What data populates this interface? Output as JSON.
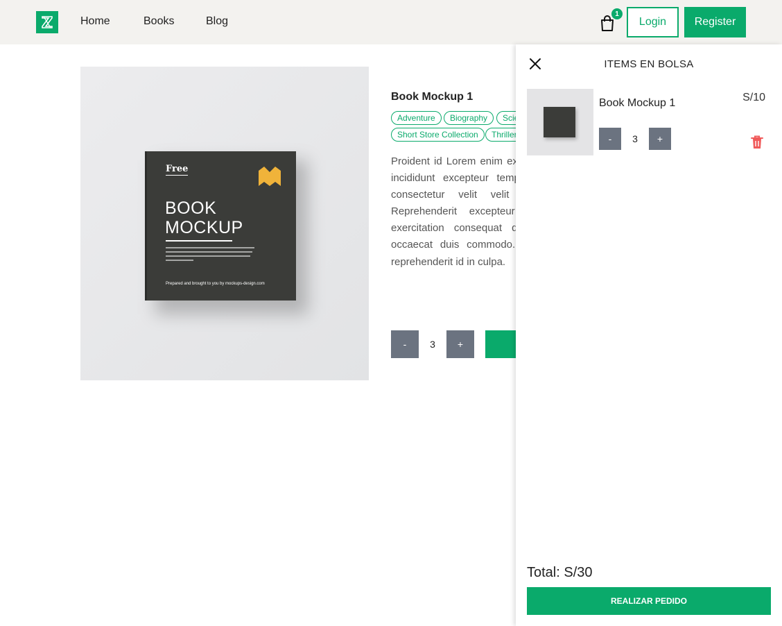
{
  "colors": {
    "accent": "#0aaa6b",
    "header_bg": "#f3f2ef",
    "qty_button": "#6b7380",
    "trash": "#f05a5a"
  },
  "header": {
    "logo_icon": "hourglass-z-icon",
    "nav": [
      {
        "label": "Home"
      },
      {
        "label": "Books"
      },
      {
        "label": "Blog"
      }
    ],
    "bag_icon": "shopping-bag-icon",
    "bag_count": "1",
    "login_label": "Login",
    "register_label": "Register"
  },
  "product": {
    "image_alt": "book-mockup-cover",
    "cover_text": {
      "free": "Free",
      "line1": "BOOK",
      "line2": "MOCKUP",
      "footer": "Prepared and brought to you by mockups-design.com"
    },
    "title": "Book Mockup 1",
    "tags": [
      "Adventure",
      "Biography",
      "Science",
      "Short Store Collection",
      "Thriller"
    ],
    "description": "Proident id Lorem enim excepteur voluptate incididunt excepteur tempor reprehenderit consectetur velit velit ipsum tempor. Reprehenderit excepteur labore laboris exercitation consequat dolor et ullamco occaecat duis commodo. In culpa minim reprehenderit id in culpa.",
    "quantity": {
      "minus": "-",
      "value": "3",
      "plus": "+"
    }
  },
  "cart": {
    "close_icon": "close-icon",
    "title": "ITEMS EN BOLSA",
    "items": [
      {
        "name": "Book Mockup 1",
        "price": "S/10",
        "minus": "-",
        "quantity": "3",
        "plus": "+",
        "trash_icon": "trash-icon"
      }
    ],
    "total": "Total: S/30",
    "checkout_label": "REALIZAR PEDIDO"
  }
}
